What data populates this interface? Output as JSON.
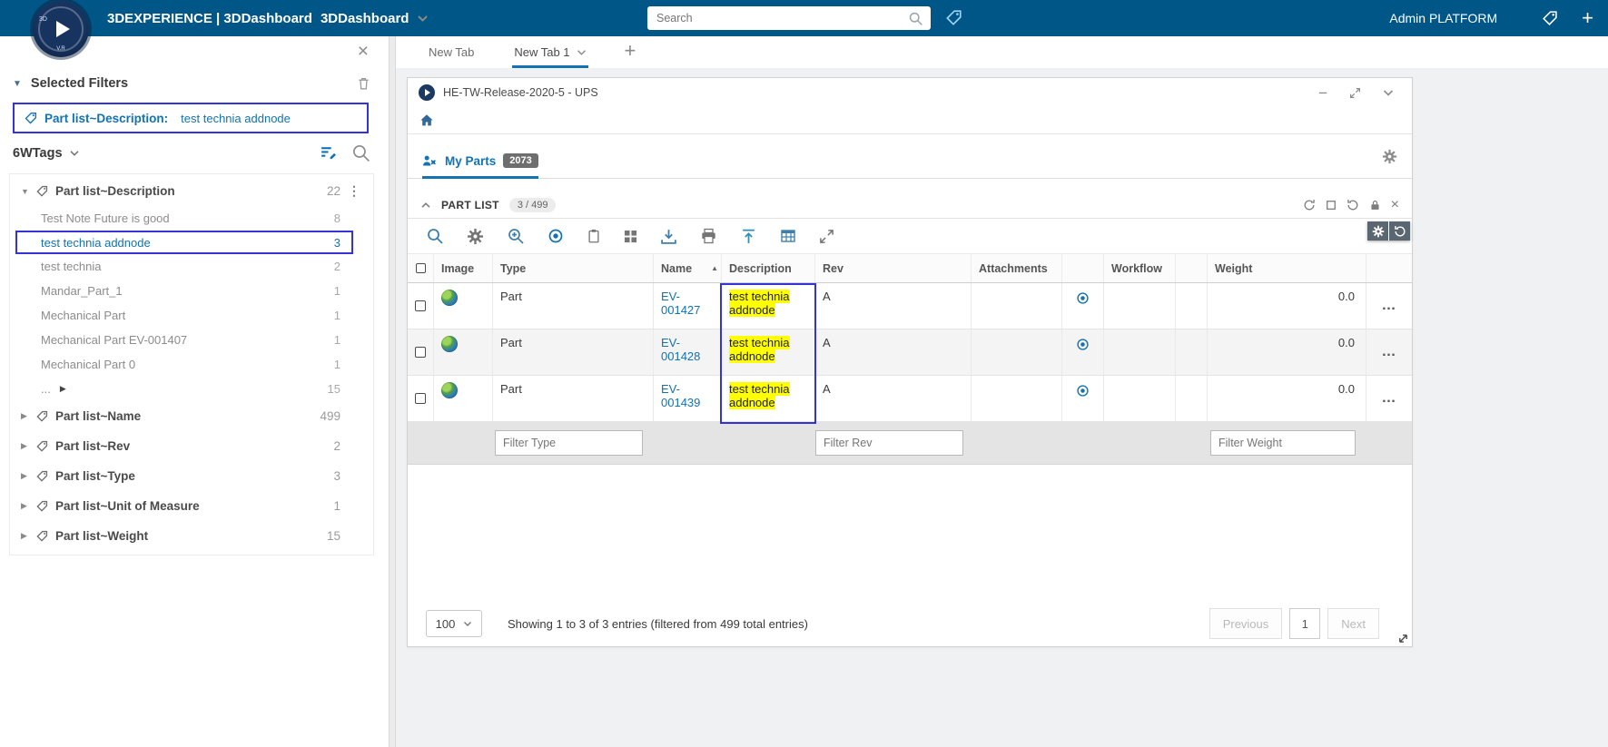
{
  "colors": {
    "topbar_bg": "#005686",
    "accent_blue": "#1272b4",
    "selection_border": "#3434d6",
    "highlight_yellow": "#ffff00"
  },
  "icons": {
    "close": "×",
    "plus": "+",
    "minus": "−",
    "kebab": "⋮",
    "menu_dots": "…",
    "sort_asc": "▲",
    "caret_down": "▼",
    "caret_right": "▶"
  },
  "topbar": {
    "brand": "3DEXPERIENCE | 3DDashboard",
    "app": "3DDashboard",
    "search_placeholder": "Search",
    "user": "Admin PLATFORM",
    "logo_text_top": "3D",
    "logo_text_bottom": "V.R"
  },
  "sidebar": {
    "selected_filters_title": "Selected Filters",
    "chip_label": "Part list~Description:",
    "chip_value": "test technia addnode",
    "tags_title": "6WTags",
    "tree": [
      {
        "label": "Part list~Description",
        "count": "22",
        "children": [
          {
            "label": "Test Note Future is good",
            "count": "8"
          },
          {
            "label": "test technia addnode",
            "count": "3"
          },
          {
            "label": "test technia",
            "count": "2"
          },
          {
            "label": "Mandar_Part_1",
            "count": "1"
          },
          {
            "label": "Mechanical Part",
            "count": "1"
          },
          {
            "label": "Mechanical Part EV-001407",
            "count": "1"
          },
          {
            "label": "Mechanical Part 0",
            "count": "1"
          },
          {
            "label": "...",
            "count": "15"
          }
        ]
      },
      {
        "label": "Part list~Name",
        "count": "499"
      },
      {
        "label": "Part list~Rev",
        "count": "2"
      },
      {
        "label": "Part list~Type",
        "count": "3"
      },
      {
        "label": "Part list~Unit of Measure",
        "count": "1"
      },
      {
        "label": "Part list~Weight",
        "count": "15"
      }
    ]
  },
  "tabs": {
    "tab1": "New Tab",
    "tab2": "New Tab 1"
  },
  "widget": {
    "title": "HE-TW-Release-2020-5 - UPS",
    "tab_label": "My Parts",
    "tab_badge": "2073",
    "panel_title": "PART LIST",
    "panel_count": "3 / 499"
  },
  "table": {
    "columns": {
      "image": "Image",
      "type": "Type",
      "name": "Name",
      "description": "Description",
      "rev": "Rev",
      "attachments": "Attachments",
      "workflow": "Workflow",
      "weight": "Weight"
    },
    "rows": [
      {
        "type": "Part",
        "name": "EV-001427",
        "description": "test technia addnode",
        "rev": "A",
        "weight": "0.0"
      },
      {
        "type": "Part",
        "name": "EV-001428",
        "description": "test technia addnode",
        "rev": "A",
        "weight": "0.0"
      },
      {
        "type": "Part",
        "name": "EV-001439",
        "description": "test technia addnode",
        "rev": "A",
        "weight": "0.0"
      }
    ],
    "filters": {
      "type": "Filter Type",
      "rev": "Filter Rev",
      "weight": "Filter Weight"
    }
  },
  "footer": {
    "page_size": "100",
    "summary": "Showing 1 to 3 of 3 entries (filtered from 499 total entries)",
    "prev": "Previous",
    "page": "1",
    "next": "Next"
  }
}
